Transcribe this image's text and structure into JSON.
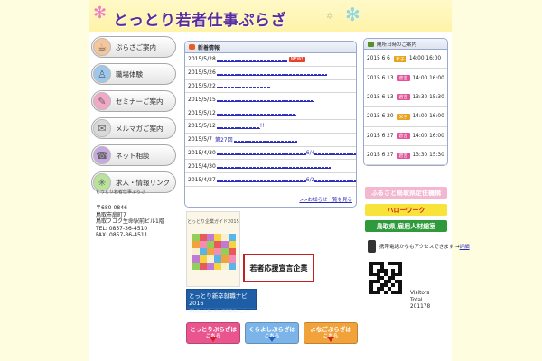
{
  "header": {
    "title": "とっとり若者仕事ぷらざ"
  },
  "nav": [
    {
      "label": "ぷらざご案内",
      "icon": "cafe-icon"
    },
    {
      "label": "職場体験",
      "icon": "person-icon"
    },
    {
      "label": "セミナーご案内",
      "icon": "pencil-icon"
    },
    {
      "label": "メルマガご案内",
      "icon": "mail-icon"
    },
    {
      "label": "ネット相談",
      "icon": "phone-icon"
    },
    {
      "label": "求人・情報リンク",
      "icon": "sparkle-icon"
    }
  ],
  "address": {
    "postal": "〒680-0846",
    "town": "鳥取市扇町7",
    "building": "鳥取フコク生命駅前ビル1階",
    "tel": "TEL: 0857-36-4510",
    "fax": "FAX: 0857-36-4511"
  },
  "news": {
    "title": "新着情報",
    "more": ">>お知らせ一覧を見る",
    "items": [
      {
        "date": "2015/5/28",
        "width": 78,
        "is_new": true,
        "new_label": "NEW!"
      },
      {
        "date": "2015/5/26",
        "width": 122
      },
      {
        "date": "2015/5/22",
        "width": 60
      },
      {
        "date": "2015/5/15",
        "width": 108
      },
      {
        "date": "2015/5/12",
        "width": 88
      },
      {
        "date": "2015/5/12",
        "width": 48,
        "suffix": "!!"
      },
      {
        "date": "2015/5/7",
        "width": 70,
        "prefix": "第27回"
      },
      {
        "date": "2015/4/30",
        "width": 100,
        "mid": "6/4",
        "width2": 46
      },
      {
        "date": "2015/4/30",
        "width": 126
      },
      {
        "date": "2015/4/27",
        "width": 100,
        "mid": "6/2",
        "width2": 46
      }
    ]
  },
  "banners": {
    "guide_title": "とっとり企業ガイド2015",
    "navi_title": "とっとり新卒就職ナビ2016",
    "navi_sub": "鳥取県内企業の新卒採用情報はこちら",
    "sengen": "若者応援宣言企業"
  },
  "bottom_buttons": [
    {
      "title": "とっとりぷらざは",
      "sub": "こちら",
      "color": "#e9568f",
      "arrow": "#d32020"
    },
    {
      "title": "くらよしぷらざは",
      "sub": "こちら",
      "color": "#7ab4e8",
      "arrow": "#1f5fc2"
    },
    {
      "title": "よなごぷらざは",
      "sub": "こちら",
      "color": "#f2a23a",
      "arrow": "#d32020"
    }
  ],
  "schedule": {
    "title": "開所日時のご案内",
    "rows": [
      {
        "date": "2015 6 6",
        "badge": "米子",
        "badge_color": "#e8a21f",
        "time": "14:00 16:00"
      },
      {
        "date": "2015 6 13",
        "badge": "倉吉",
        "badge_color": "#e0559a",
        "time": "14:00 16:00"
      },
      {
        "date": "2015 6 13",
        "badge": "倉吉",
        "badge_color": "#e0559a",
        "time": "13:30 15:30"
      },
      {
        "date": "2015 6 20",
        "badge": "米子",
        "badge_color": "#e8a21f",
        "time": "14:00 16:00"
      },
      {
        "date": "2015 6 27",
        "badge": "倉吉",
        "badge_color": "#e0559a",
        "time": "14:00 16:00"
      },
      {
        "date": "2015 6 27",
        "badge": "倉吉",
        "badge_color": "#e0559a",
        "time": "13:30 15:30"
      }
    ]
  },
  "right_banners": [
    {
      "label": "ふるさと鳥取県定住機構",
      "bg": "#f3b7cf",
      "fg": "#ffffff"
    },
    {
      "label": "ハローワーク",
      "bg": "#f7e33a",
      "fg": "#d41818"
    },
    {
      "label": "鳥取県 雇用人材総室",
      "bg": "#2f9a3b",
      "fg": "#ffffff"
    }
  ],
  "mobile": {
    "label": "携帯電話からもアクセスできます →",
    "link": "詳細"
  },
  "visitors": {
    "label1": "Visitors",
    "label2": "Total",
    "count": "201178"
  }
}
